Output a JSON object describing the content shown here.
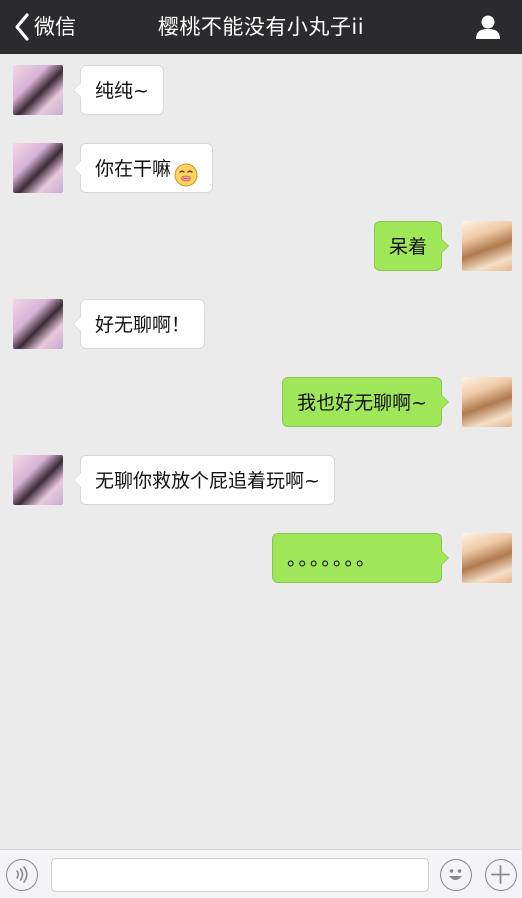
{
  "header": {
    "back_label": "微信",
    "title": "樱桃不能没有小丸子ii",
    "background": "#2b2b2d"
  },
  "messages": [
    {
      "side": "left",
      "text": "纯纯~",
      "emoji": ""
    },
    {
      "side": "left",
      "text": "你在干嘛",
      "emoji": "shushing-face"
    },
    {
      "side": "right",
      "text": "呆着",
      "emoji": ""
    },
    {
      "side": "left",
      "text": "好无聊啊！",
      "emoji": ""
    },
    {
      "side": "right",
      "text": "我也好无聊啊~",
      "emoji": ""
    },
    {
      "side": "left",
      "text": "无聊你救放个屁追着玩啊~",
      "emoji": ""
    },
    {
      "side": "right",
      "text": "。。。。。。。",
      "emoji": ""
    }
  ],
  "colors": {
    "chat_background": "#ebebeb",
    "sent_bubble": "#9fe658",
    "received_bubble": "#ffffff"
  },
  "input_bar": {
    "voice_icon": "voice-icon",
    "emoji_icon": "smiley-icon",
    "more_icon": "plus-icon",
    "text_value": ""
  }
}
